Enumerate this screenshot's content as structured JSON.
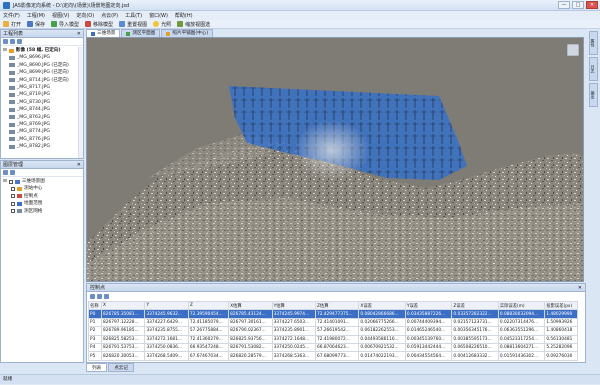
{
  "window": {
    "title": "JAS影像定向系统 - D:\\定向\\(场景)\\场景地图定向.jsd",
    "min": "—",
    "max": "□",
    "close": "✕"
  },
  "menu": [
    "文件(F)",
    "工程(M)",
    "视图(V)",
    "定向(O)",
    "点云(P)",
    "工具(T)",
    "窗口(W)",
    "帮助(H)"
  ],
  "toolbar": {
    "open": "打开",
    "save": "保存",
    "import_model": "导入模型",
    "remove_model": "移除模型",
    "reset_view": "重置视图",
    "light": "光照",
    "scale_view": "缩放视图选"
  },
  "project_panel": {
    "title": "工程列表",
    "root": "影像 (58 幅, 已定向)",
    "items": [
      "_MG_8696.JPG",
      "_MG_8690.JPG (已定向)",
      "_MG_8699.JPG (已定向)",
      "_MG_8714.JPG (已定向)",
      "_MG_8717.JPG",
      "_MG_8719.JPG",
      "_MG_8730.JPG",
      "_MG_8744.JPG",
      "_MG_8763.JPG",
      "_MG_8769.JPG",
      "_MG_8774.JPG",
      "_MG_8776.JPG",
      "_MG_8782.JPG"
    ]
  },
  "layer_panel": {
    "title": "图层管理",
    "root": "三维场景图",
    "items": [
      "测站中心",
      "控制点",
      "地面范围",
      "测区网格"
    ]
  },
  "tabs": [
    "三维场景",
    "测区平面图",
    "照片平铺图(中心)"
  ],
  "right_tabs": [
    "属性",
    "日志",
    "输出"
  ],
  "control_panel": {
    "title": "控制点",
    "columns": [
      "名称",
      "X",
      "Y",
      "Z",
      "X估算",
      "Y估算",
      "Z估算",
      "X误差",
      "Y误差",
      "Z误差",
      "实际误差(m)",
      "投影误差(px)"
    ],
    "rows": [
      [
        "P0",
        "826785.35081...",
        "3374245.9632...",
        "72.39590454...",
        "826785.43124...",
        "3374245.9974...",
        "72.429477375...",
        "0.08042866686...",
        "0.03435887226...",
        "0.03357282322...",
        "0.08830032094...",
        "1.48029990"
      ],
      [
        "P1",
        "826797.12228...",
        "3374227.6429...",
        "72.41185079...",
        "826797.30161...",
        "3374227.6503...",
        "72.41401091...",
        "0.02066775266...",
        "0.00744409394...",
        "0.02157123731...",
        "0.02207314476...",
        "1.50993926"
      ],
      [
        "P2",
        "826789.96185...",
        "3374235.8755...",
        "57.26775884...",
        "826790.02367...",
        "3374235.8901...",
        "57.26619542...",
        "0.06182262553...",
        "0.01465246540...",
        "0.00356345176...",
        "0.06363551296...",
        "1.40860418"
      ],
      [
        "P3",
        "826825.58253...",
        "3374272.1681...",
        "72.41360279...",
        "826825.93756...",
        "3374272.1648...",
        "72.41980072...",
        "0.04493586116...",
        "0.00345139760...",
        "0.00385595173...",
        "0.04523317254...",
        "0.56130481"
      ],
      [
        "P4",
        "826791.53753...",
        "3374250.0836...",
        "66.93547248...",
        "826791.53082...",
        "3374250.0245...",
        "66.87064623...",
        "0.00670921532...",
        "0.05913442444...",
        "0.06508226510...",
        "0.08813604271...",
        "5.25282096"
      ],
      [
        "P5",
        "826820.30053...",
        "3374268.5409...",
        "67.67467034...",
        "826820.28579...",
        "3374268.5363...",
        "67.68099773...",
        "0.01474022193...",
        "0.00434554564...",
        "0.00412683332...",
        "0.01591436302...",
        "0.09276030"
      ]
    ]
  },
  "bottom_tabs": [
    "列表",
    "点云记"
  ],
  "status": "就绪",
  "colors": {
    "accent": "#3b6fc6",
    "frame": "#dbe6f4",
    "viewport_bg": "#7f7c75",
    "patch_blue": "#2f6fd0"
  }
}
